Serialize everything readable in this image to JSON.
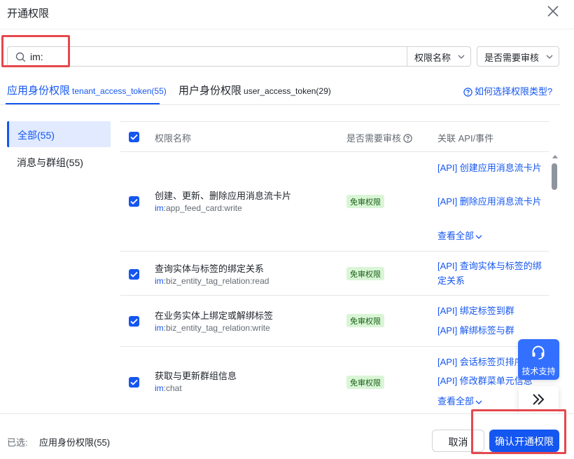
{
  "dialog": {
    "title": "开通权限",
    "close_icon": "close-icon"
  },
  "search": {
    "value": "im:",
    "filter_name_label": "权限名称",
    "filter_review_label": "是否需要审核"
  },
  "tabs": [
    {
      "label": "应用身份权限",
      "sub": "tenant_access_token(55)",
      "active": true
    },
    {
      "label": "用户身份权限",
      "sub": "user_access_token(29)",
      "active": false
    }
  ],
  "help_link": "如何选择权限类型?",
  "sidebar": {
    "items": [
      {
        "label": "全部(55)",
        "active": true
      },
      {
        "label": "消息与群组(55)",
        "active": false
      }
    ]
  },
  "table": {
    "headers": {
      "name": "权限名称",
      "review": "是否需要审核",
      "api": "关联 API/事件"
    },
    "rows": [
      {
        "name": "创建、更新、删除应用消息流卡片",
        "code_prefix": "im",
        "code_rest": ":app_feed_card:write",
        "badge": "免审权限",
        "apis": [
          "[API] 创建应用消息流卡片",
          "[API] 删除应用消息流卡片"
        ],
        "view_all": "查看全部",
        "checked": true
      },
      {
        "name": "查询实体与标签的绑定关系",
        "code_prefix": "im",
        "code_rest": ":biz_entity_tag_relation:read",
        "badge": "免审权限",
        "apis": [
          "[API] 查询实体与标签的绑定关系"
        ],
        "checked": true
      },
      {
        "name": "在业务实体上绑定或解绑标签",
        "code_prefix": "im",
        "code_rest": ":biz_entity_tag_relation:write",
        "badge": "免审权限",
        "apis": [
          "[API] 绑定标签到群",
          "[API] 解绑标签与群"
        ],
        "checked": true
      },
      {
        "name": "获取与更新群组信息",
        "code_prefix": "im",
        "code_rest": ":chat",
        "badge": "免审权限",
        "apis": [
          "[API] 会话标签页排序",
          "[API] 修改群菜单元信息"
        ],
        "view_all": "查看全部",
        "checked": true
      }
    ]
  },
  "floating": {
    "support_label": "技术支持",
    "collapse_label": "收起"
  },
  "footer": {
    "selected_label": "已选:",
    "selected_value": "应用身份权限(55)",
    "cancel_label": "取消",
    "confirm_label": "确认开通权限"
  },
  "colors": {
    "primary": "#1456f0",
    "highlight_box": "#e5484d",
    "badge_bg": "#d9f5d6",
    "badge_text": "#186014"
  }
}
